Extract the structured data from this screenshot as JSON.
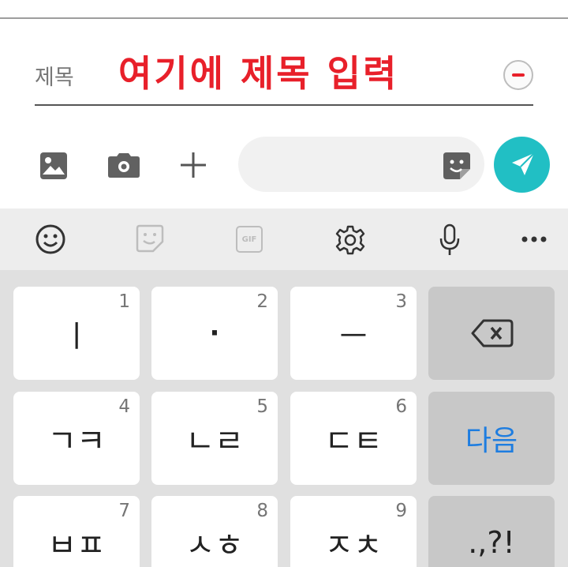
{
  "title_row": {
    "label": "제목",
    "input_value": "여기에 제목 입력"
  },
  "compose": {
    "icons": [
      "image-icon",
      "camera-icon",
      "plus-icon",
      "sticker-icon",
      "send-icon"
    ],
    "message_value": ""
  },
  "keyboard_toolbar": {
    "icons": [
      "emoji-icon",
      "sticker-icon",
      "gif-icon",
      "settings-icon",
      "microphone-icon",
      "more-icon"
    ],
    "gif_label": "GIF"
  },
  "keys": [
    {
      "num": "1",
      "label": "ㅣ"
    },
    {
      "num": "2",
      "label": "·"
    },
    {
      "num": "3",
      "label": "ㅡ"
    },
    {
      "num": "",
      "label": ""
    },
    {
      "num": "4",
      "label": "ㄱㅋ"
    },
    {
      "num": "5",
      "label": "ㄴㄹ"
    },
    {
      "num": "6",
      "label": "ㄷㅌ"
    },
    {
      "num": "",
      "label": "다음"
    },
    {
      "num": "7",
      "label": "ㅂㅍ"
    },
    {
      "num": "8",
      "label": "ㅅㅎ"
    },
    {
      "num": "9",
      "label": "ㅈㅊ"
    },
    {
      "num": "",
      "label": ".,?!"
    }
  ],
  "colors": {
    "title_text": "#e8202a",
    "send_button": "#21bfc4",
    "next_key_text": "#1e7de0",
    "keyboard_bg": "#e0e0e0"
  }
}
